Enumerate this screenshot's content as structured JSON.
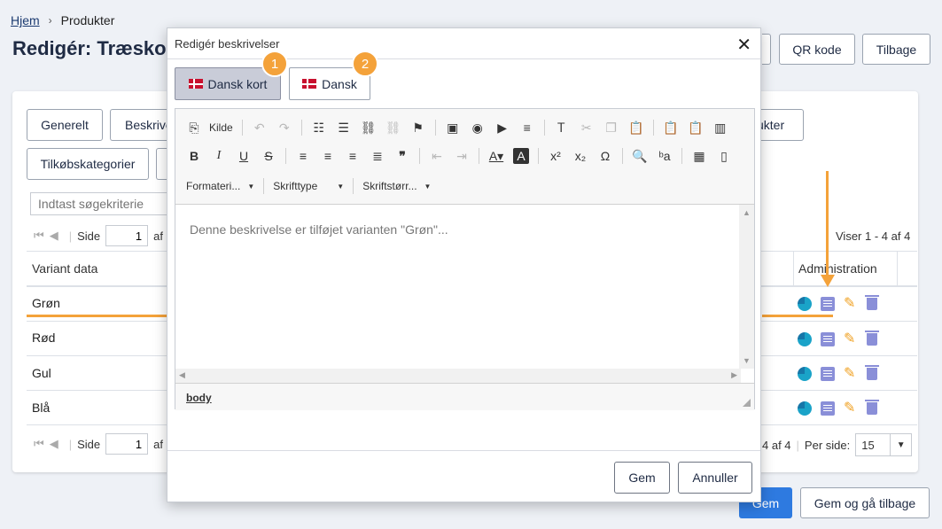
{
  "breadcrumb": {
    "home": "Hjem",
    "separator": "›",
    "current": "Produkter"
  },
  "page": {
    "title": "Redigér: Træsko"
  },
  "header_buttons": {
    "qr": "QR kode",
    "back": "Tilbage"
  },
  "tabs": {
    "general": "Generelt",
    "descriptions": "Beskrive",
    "products": "ukter",
    "addon_categories": "Tilkøbskategorier"
  },
  "search": {
    "placeholder": "Indtast søgekriterie"
  },
  "pager": {
    "side_label": "Side",
    "page_value": "1",
    "of_short": "af",
    "showing": "Viser 1 - 4 af 4",
    "bottom_of": "4 af 4",
    "per_page_label": "Per side:",
    "per_page_value": "15"
  },
  "table": {
    "col_variant": "Variant data",
    "col_admin": "Administration",
    "rows": [
      {
        "name": "Grøn"
      },
      {
        "name": "Rød"
      },
      {
        "name": "Gul"
      },
      {
        "name": "Blå"
      }
    ]
  },
  "footer_buttons": {
    "save": "Gem",
    "save_back": "Gem og gå tilbage"
  },
  "modal": {
    "title": "Redigér beskrivelser",
    "close": "✕",
    "lang_tabs": [
      {
        "label": "Dansk kort",
        "badge": "1"
      },
      {
        "label": "Dansk",
        "badge": "2"
      }
    ],
    "toolbar": {
      "source": "Kilde",
      "format": "Formateri...",
      "font": "Skrifttype",
      "size": "Skriftstørr..."
    },
    "editor_text": "Denne beskrivelse er tilføjet varianten \"Grøn\"...",
    "status_path": "body",
    "save": "Gem",
    "cancel": "Annuller"
  },
  "colors": {
    "accent_orange": "#f4a23a",
    "primary_blue": "#2e7ae0"
  }
}
